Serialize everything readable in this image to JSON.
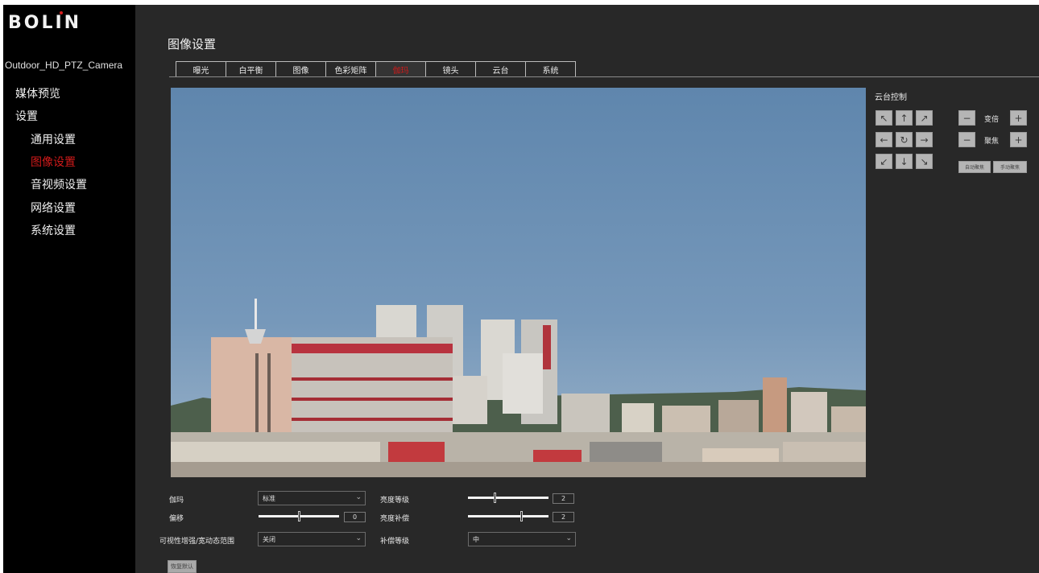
{
  "brand": {
    "logo_text": "BOLIN",
    "logo_dot_color": "#d81e1e"
  },
  "device_name": "Outdoor_HD_PTZ_Camera",
  "nav": {
    "media_preview": "媒体预览",
    "settings": "设置",
    "sub": [
      {
        "label": "通用设置",
        "active": false
      },
      {
        "label": "图像设置",
        "active": true
      },
      {
        "label": "音视频设置",
        "active": false
      },
      {
        "label": "网络设置",
        "active": false
      },
      {
        "label": "系统设置",
        "active": false
      }
    ]
  },
  "page_title": "图像设置",
  "tabs": [
    {
      "label": "曝光"
    },
    {
      "label": "白平衡"
    },
    {
      "label": "图像"
    },
    {
      "label": "色彩矩阵"
    },
    {
      "label": "伽玛",
      "active": true
    },
    {
      "label": "镜头"
    },
    {
      "label": "云台"
    },
    {
      "label": "系统"
    }
  ],
  "ptz": {
    "title": "云台控制",
    "icons": {
      "up_left": "↖",
      "up": "↑",
      "up_right": "↗",
      "left": "←",
      "home": "↻",
      "right": "→",
      "down_left": "↙",
      "down": "↓",
      "down_right": "↘"
    },
    "zoom_label": "变倍",
    "focus_label": "聚焦",
    "minus": "−",
    "plus": "+",
    "auto_focus": "自动聚焦",
    "manual_focus": "手动聚焦"
  },
  "settings": {
    "gamma_label": "伽玛",
    "gamma_value": "标准",
    "offset_label": "偏移",
    "offset_value": "0",
    "offset_level": 0.5,
    "wdr_label": "可视性增强/宽动态范围",
    "wdr_value": "关闭",
    "brightness_level_label": "亮度等级",
    "brightness_level_value": "2",
    "brightness_level_fraction": 0.33,
    "brightness_comp_label": "亮度补偿",
    "brightness_comp_value": "2",
    "brightness_comp_fraction": 0.67,
    "comp_level_label": "补偿等级",
    "comp_level_value": "中",
    "chevron": "⌄"
  },
  "restore_default": "恢复默认",
  "colors": {
    "active_red": "#d01a1a",
    "sky": "#6e92b6"
  }
}
